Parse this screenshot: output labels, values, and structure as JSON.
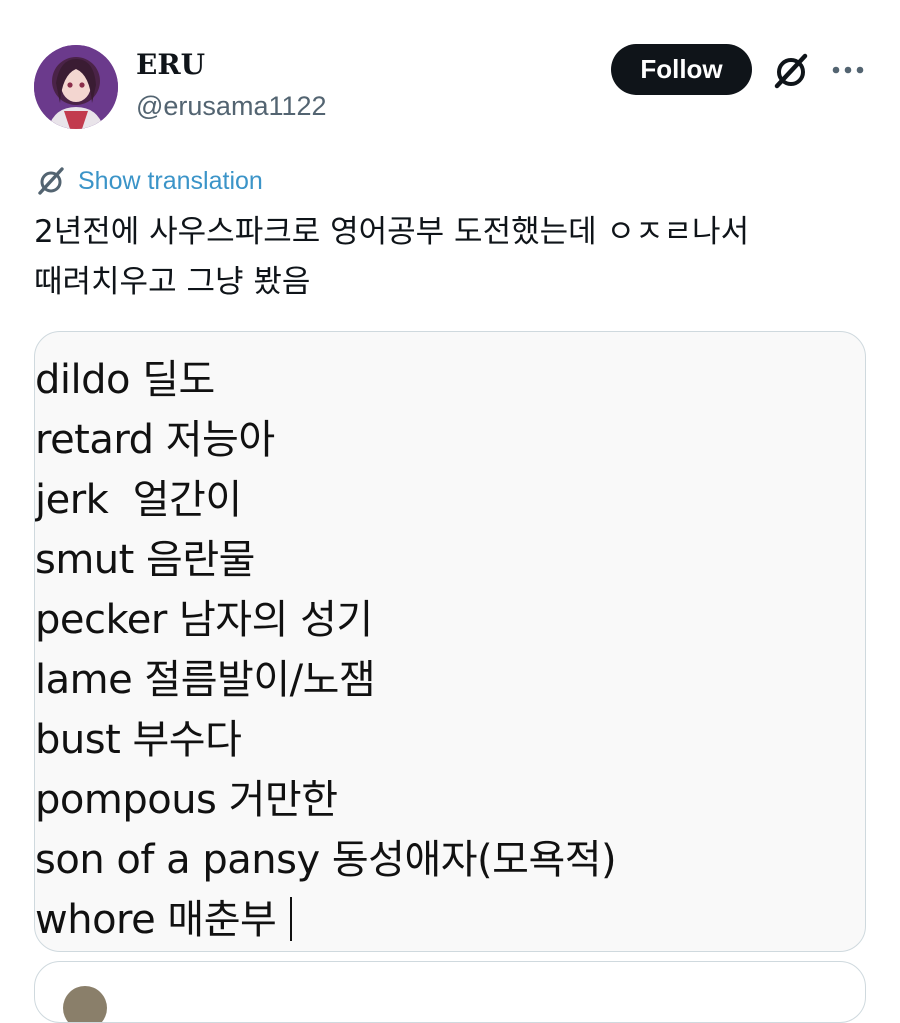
{
  "author": {
    "display_name": "ERU",
    "handle": "@erusama1122"
  },
  "actions": {
    "follow_label": "Follow",
    "grok_icon": "grok-slash-icon",
    "more_icon": "more-dots-icon"
  },
  "translation": {
    "label": "Show translation",
    "icon": "translate-slash-icon"
  },
  "tweet": {
    "lines": [
      "2년전에 사우스파크로 영어공부 도전했는데 ㅇㅈㄹ나서",
      "때려치우고 그냥 봤음"
    ]
  },
  "media": {
    "vocab": [
      "dildo 딜도",
      "retard 저능아",
      "jerk  얼간이",
      "smut 음란물",
      "pecker 남자의 성기",
      "lame 절름발이/노잼",
      "bust 부수다",
      "pompous 거만한",
      "son of a pansy 동성애자(모욕적)",
      "whore 매춘부"
    ]
  },
  "colors": {
    "link": "#3b94c8",
    "follow_bg": "#0f1419",
    "border": "#cfd9de"
  }
}
